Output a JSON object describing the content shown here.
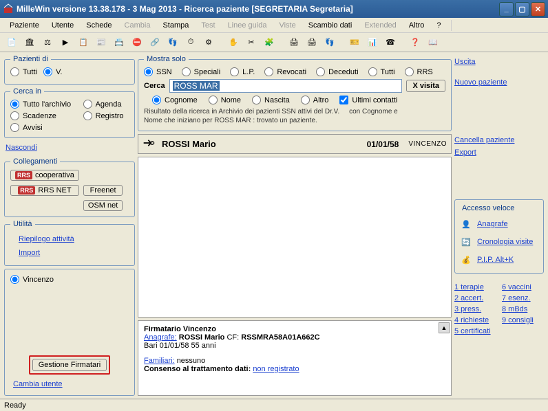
{
  "window": {
    "title": "MilleWin versione 13.38.178 - 3 Mag 2013 - Ricerca paziente [SEGRETARIA Segretaria]"
  },
  "menu": {
    "paziente": "Paziente",
    "utente": "Utente",
    "schede": "Schede",
    "cambia": "Cambia",
    "stampa": "Stampa",
    "test": "Test",
    "linee": "Linee guida",
    "viste": "Viste",
    "scambio": "Scambio dati",
    "extended": "Extended",
    "altro": "Altro",
    "help": "?"
  },
  "left": {
    "pazienti_di": {
      "legend": "Pazienti di",
      "tutti": "Tutti",
      "v": "V."
    },
    "cerca_in": {
      "legend": "Cerca in",
      "tutto": "Tutto l'archivio",
      "agenda": "Agenda",
      "scadenze": "Scadenze",
      "registro": "Registro",
      "avvisi": "Avvisi"
    },
    "nascondi": "Nascondi",
    "collegamenti": {
      "legend": "Collegamenti",
      "cooperativa": "cooperativa",
      "rrsnet": "RRS NET",
      "freenet": "Freenet",
      "osmnet": "OSM net"
    },
    "utilita": {
      "legend": "Utilità",
      "riepilogo": "Riepilogo attività",
      "import": "Import"
    },
    "firmatario": {
      "vincenzo": "Vincenzo",
      "gestione": "Gestione Firmatari",
      "cambia": "Cambia utente"
    }
  },
  "mid": {
    "mostra_solo": {
      "legend": "Mostra solo",
      "ssn": "SSN",
      "speciali": "Speciali",
      "lp": "L.P.",
      "revocati": "Revocati",
      "deceduti": "Deceduti",
      "tutti": "Tutti",
      "rrs": "RRS"
    },
    "cerca": {
      "label": "Cerca",
      "value": "ROSS MAR",
      "xvisita": "X visita",
      "cognome": "Cognome",
      "nome": "Nome",
      "nascita": "Nascita",
      "altro": "Altro",
      "ultimi": "Ultimi contatti",
      "note1": "Risultato della ricerca in Archivio dei pazienti SSN attivi del Dr.V.",
      "note1b": "con Cognome e",
      "note2": "Nome che iniziano per ROSS MAR : trovato un paziente."
    },
    "result": {
      "name": "ROSSI Mario",
      "date": "01/01/58",
      "doctor": "VINCENZO"
    },
    "detail": {
      "firmatario_label": "Firmatario",
      "firmatario_name": "Vincenzo",
      "anagrafe_label": "Anagrafe:",
      "anagrafe_name": "ROSSI Mario",
      "cf_label": "CF:",
      "cf_value": "RSSMRA58A01A662C",
      "born": "Bari 01/01/58 55 anni",
      "familiari_label": "Familiari:",
      "familiari_value": "nessuno",
      "consenso_label": "Consenso al trattamento dati:",
      "consenso_value": "non registrato"
    }
  },
  "right": {
    "uscita": "Uscita",
    "nuovo": "Nuovo paziente",
    "cancella": "Cancella paziente",
    "export": "Export",
    "accesso": {
      "legend": "Accesso veloce",
      "anagrafe": "Anagrafe",
      "cronologia": "Cronologia visite",
      "pip": "P.I.P.  Alt+K"
    },
    "links": {
      "terapie": "1 terapie",
      "vaccini": "6 vaccini",
      "accert": "2 accert.",
      "esenz": "7 esenz.",
      "press": "3 press.",
      "mbds": "8 mBds",
      "richieste": "4 richieste",
      "consigli": "9 consigli",
      "certificati": "5 certificati"
    }
  },
  "status": {
    "ready": "Ready"
  }
}
